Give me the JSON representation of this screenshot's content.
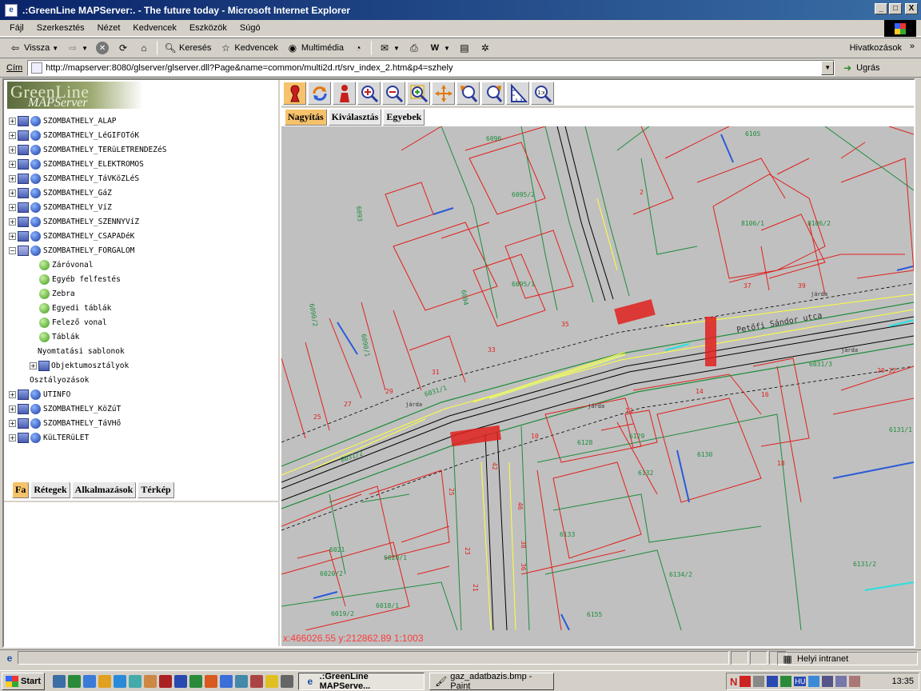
{
  "window": {
    "title": ".:GreenLine MAPServer:. - The future today - Microsoft Internet Explorer",
    "buttons": {
      "minimize": "_",
      "maximize": "□",
      "close": "X"
    }
  },
  "menu": [
    "Fájl",
    "Szerkesztés",
    "Nézet",
    "Kedvencek",
    "Eszközök",
    "Súgó"
  ],
  "toolbar": {
    "back": "Vissza",
    "search": "Keresés",
    "favorites": "Kedvencek",
    "multimedia": "Multimédia",
    "links": "Hivatkozások"
  },
  "address": {
    "label": "Cím",
    "url": "http://mapserver:8080/glserver/glserver.dll?Page&name=common/multi2d.rt/srv_index_2.htm&p4=szhely",
    "go": "Ugrás"
  },
  "logo": {
    "line1": "GreenLine",
    "line2": "MAPServer"
  },
  "tree": {
    "layers": [
      "SZOMBATHELY_ALAP",
      "SZOMBATHELY_LéGIFOTóK",
      "SZOMBATHELY_TERüLETRENDEZéS",
      "SZOMBATHELY_ELEKTROMOS",
      "SZOMBATHELY_TáVKöZLéS",
      "SZOMBATHELY_GáZ",
      "SZOMBATHELY_VíZ",
      "SZOMBATHELY_SZENNYVíZ",
      "SZOMBATHELY_CSAPADéK",
      "SZOMBATHELY_FORGALOM"
    ],
    "forgalom_children": [
      "Záróvonal",
      "Egyéb felfestés",
      "Zebra",
      "Egyedi táblák",
      "Felező vonal",
      "Táblák"
    ],
    "misc": [
      "Nyomtatási sablonok",
      "Objektumosztályok",
      "Osztályozások"
    ],
    "layers_after": [
      "UTINFO",
      "SZOMBATHELY_KöZúT",
      "SZOMBATHELY_TáVHő",
      "KüLTERüLET"
    ]
  },
  "left_tabs": [
    "Fa",
    "Rétegek",
    "Alkalmazások",
    "Térkép"
  ],
  "map_tabs": [
    "Nagyítás",
    "Kiválasztás",
    "Egyebek"
  ],
  "map_labels": {
    "parcels": [
      "6096",
      "6095/2",
      "6105",
      "8106/1",
      "8106/2",
      "6095/1",
      "6094",
      "6090/2",
      "6090/1",
      "6031/1",
      "6031/2",
      "6031/3",
      "6128",
      "6129",
      "6130",
      "6132",
      "6133",
      "6134/2",
      "6131/1",
      "6131/2",
      "6021",
      "6020/1",
      "6020/2",
      "6018/1",
      "6019/2",
      "6155",
      "6093"
    ],
    "house_numbers": [
      "2",
      "37",
      "39",
      "35",
      "33",
      "31",
      "29",
      "27",
      "25",
      "14",
      "16",
      "18",
      "12",
      "10",
      "20-22",
      "25",
      "42",
      "46",
      "38",
      "36",
      "23",
      "21"
    ],
    "street": "Petőfi Sándor utca",
    "sidewalk": "járda"
  },
  "coordinates": "x:466026.55 y:212862.89  1:1003",
  "status": {
    "zone": "Helyi intranet"
  },
  "taskbar": {
    "start": "Start",
    "tasks": [
      ".:GreenLine MAPServe...",
      "gaz_adatbazis.bmp - Paint"
    ],
    "tray_letters": [
      "N",
      "HU"
    ],
    "clock": "13:35"
  },
  "colors": {
    "titlebar": "#0a246a",
    "map_bg": "#c0c0c0",
    "parcel_line": "#e0201c",
    "green_line": "#1e8c3c",
    "yellow_line": "#ffff3c",
    "coord_text": "#ff3b3b",
    "tab_active": "#f6c26b"
  }
}
